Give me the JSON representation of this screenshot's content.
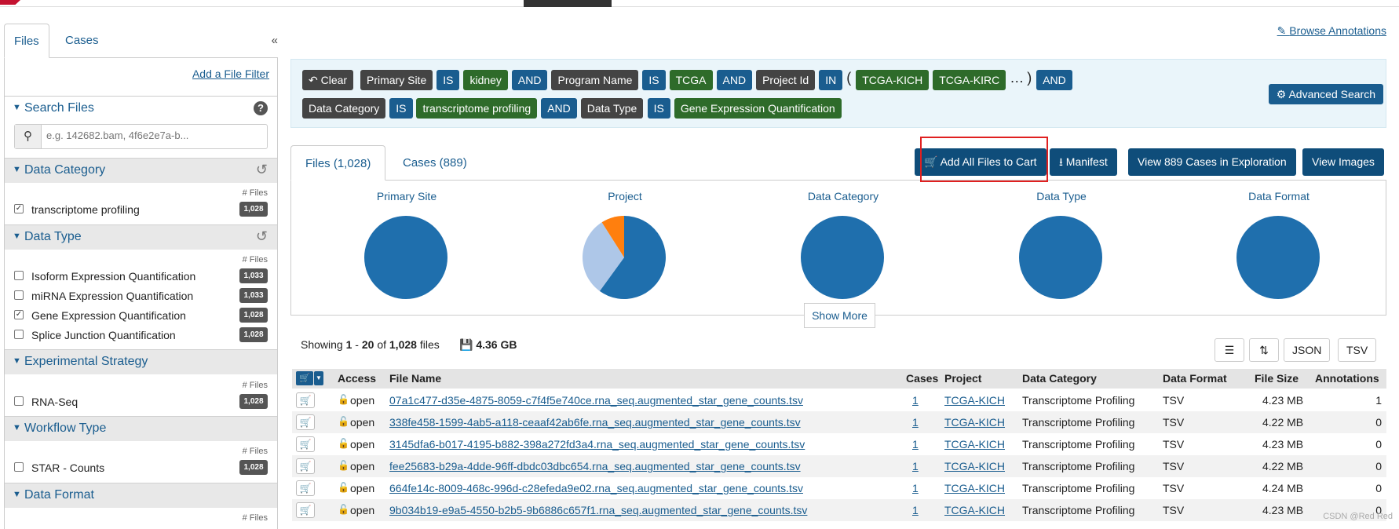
{
  "sidebar": {
    "tabs": [
      "Files",
      "Cases"
    ],
    "add_file_filter": "Add a File Filter",
    "search_title": "Search Files",
    "search_placeholder": "e.g. 142682.bam, 4f6e2e7a-b...",
    "files_label": "# Files",
    "facets": [
      {
        "title": "Data Category",
        "rows": [
          {
            "label": "transcriptome profiling",
            "count": "1,028",
            "checked": true
          }
        ]
      },
      {
        "title": "Data Type",
        "rows": [
          {
            "label": "Isoform Expression Quantification",
            "count": "1,033",
            "checked": false
          },
          {
            "label": "miRNA Expression Quantification",
            "count": "1,033",
            "checked": false
          },
          {
            "label": "Gene Expression Quantification",
            "count": "1,028",
            "checked": true
          },
          {
            "label": "Splice Junction Quantification",
            "count": "1,028",
            "checked": false
          }
        ]
      },
      {
        "title": "Experimental Strategy",
        "rows": [
          {
            "label": "RNA-Seq",
            "count": "1,028",
            "checked": false
          }
        ]
      },
      {
        "title": "Workflow Type",
        "rows": [
          {
            "label": "STAR - Counts",
            "count": "1,028",
            "checked": false
          }
        ]
      },
      {
        "title": "Data Format",
        "rows": []
      }
    ]
  },
  "browse_annotations": "Browse Annotations",
  "query": {
    "clear": "Clear",
    "line1": [
      {
        "t": "Primary Site",
        "k": "dark"
      },
      {
        "t": "IS",
        "k": "blue"
      },
      {
        "t": "kidney",
        "k": "green"
      },
      {
        "t": "AND",
        "k": "blue"
      },
      {
        "t": "Program Name",
        "k": "dark"
      },
      {
        "t": "IS",
        "k": "blue"
      },
      {
        "t": "TCGA",
        "k": "green"
      },
      {
        "t": "AND",
        "k": "blue"
      },
      {
        "t": "Project Id",
        "k": "dark"
      },
      {
        "t": "IN",
        "k": "blue"
      },
      {
        "t": "TCGA-KICH",
        "k": "green"
      },
      {
        "t": "TCGA-KIRC",
        "k": "green"
      },
      {
        "t": "AND",
        "k": "blue"
      }
    ],
    "paren_open": "(",
    "ellipsis": "…",
    "paren_close": ")",
    "line2": [
      {
        "t": "Data Category",
        "k": "dark"
      },
      {
        "t": "IS",
        "k": "blue"
      },
      {
        "t": "transcriptome profiling",
        "k": "green"
      },
      {
        "t": "AND",
        "k": "blue"
      },
      {
        "t": "Data Type",
        "k": "dark"
      },
      {
        "t": "IS",
        "k": "blue"
      },
      {
        "t": "Gene Expression Quantification",
        "k": "green"
      }
    ],
    "advanced_search": "Advanced Search"
  },
  "main_tabs": [
    "Files (1,028)",
    "Cases (889)"
  ],
  "actions": {
    "add_all": "Add All Files to Cart",
    "manifest": "Manifest",
    "view_cases": "View 889 Cases in Exploration",
    "view_images": "View Images"
  },
  "charts": [
    {
      "title": "Primary Site",
      "slices": [
        1.0
      ]
    },
    {
      "title": "Project",
      "slices": [
        0.6,
        0.31,
        0.09
      ]
    },
    {
      "title": "Data Category",
      "slices": [
        1.0
      ]
    },
    {
      "title": "Data Type",
      "slices": [
        1.0
      ]
    },
    {
      "title": "Data Format",
      "slices": [
        1.0
      ]
    }
  ],
  "pie_colors": [
    "#1f6fad",
    "#aec7e8",
    "#ff7f0e"
  ],
  "show_more": "Show More",
  "summary": {
    "showing": "Showing",
    "from": "1",
    "dash": "-",
    "to": "20",
    "of": "of",
    "total": "1,028",
    "files": "files",
    "size": "4.36 GB"
  },
  "table_buttons": {
    "json": "JSON",
    "tsv": "TSV"
  },
  "columns": [
    "Access",
    "File Name",
    "Cases",
    "Project",
    "Data Category",
    "Data Format",
    "File Size",
    "Annotations"
  ],
  "rows": [
    {
      "access": "open",
      "file": "07a1c477-d35e-4875-8059-c7f4f5e740ce.rna_seq.augmented_star_gene_counts.tsv",
      "cases": "1",
      "project": "TCGA-KICH",
      "category": "Transcriptome Profiling",
      "format": "TSV",
      "size": "4.23 MB",
      "ann": "1"
    },
    {
      "access": "open",
      "file": "338fe458-1599-4ab5-a118-ceaaf42ab6fe.rna_seq.augmented_star_gene_counts.tsv",
      "cases": "1",
      "project": "TCGA-KICH",
      "category": "Transcriptome Profiling",
      "format": "TSV",
      "size": "4.22 MB",
      "ann": "0"
    },
    {
      "access": "open",
      "file": "3145dfa6-b017-4195-b882-398a272fd3a4.rna_seq.augmented_star_gene_counts.tsv",
      "cases": "1",
      "project": "TCGA-KICH",
      "category": "Transcriptome Profiling",
      "format": "TSV",
      "size": "4.23 MB",
      "ann": "0"
    },
    {
      "access": "open",
      "file": "fee25683-b29a-4dde-96ff-dbdc03dbc654.rna_seq.augmented_star_gene_counts.tsv",
      "cases": "1",
      "project": "TCGA-KICH",
      "category": "Transcriptome Profiling",
      "format": "TSV",
      "size": "4.22 MB",
      "ann": "0"
    },
    {
      "access": "open",
      "file": "664fe14c-8009-468c-996d-c28efeda9e02.rna_seq.augmented_star_gene_counts.tsv",
      "cases": "1",
      "project": "TCGA-KICH",
      "category": "Transcriptome Profiling",
      "format": "TSV",
      "size": "4.24 MB",
      "ann": "0"
    },
    {
      "access": "open",
      "file": "9b034b19-e9a5-4550-b2b5-9b6886c657f1.rna_seq.augmented_star_gene_counts.tsv",
      "cases": "1",
      "project": "TCGA-KICH",
      "category": "Transcriptome Profiling",
      "format": "TSV",
      "size": "4.23 MB",
      "ann": "0"
    }
  ],
  "watermark": "CSDN @Red Red"
}
